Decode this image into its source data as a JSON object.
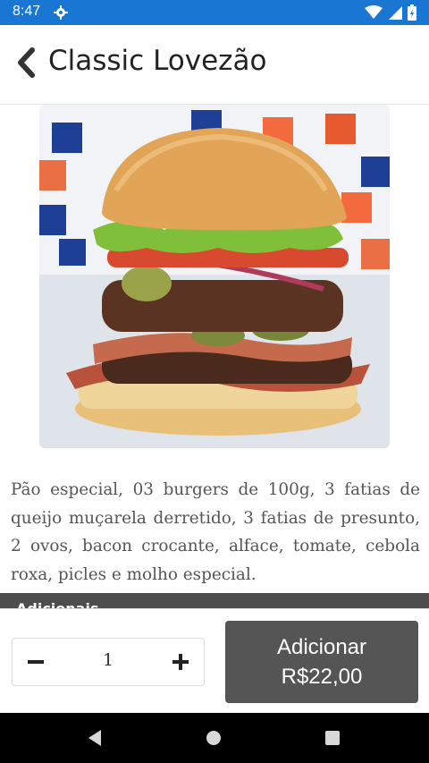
{
  "status_bar": {
    "time": "8:47",
    "icons": [
      "gear-icon",
      "wifi-icon",
      "signal-icon",
      "battery-icon"
    ],
    "color": "#1976d2"
  },
  "header": {
    "title": "Classic Lovezão",
    "back_icon": "chevron-left-icon"
  },
  "product": {
    "image": "burger-photo",
    "description": "Pão especial, 03 burgers de 100g, 3 fatias de queijo muçarela derretido, 3 fatias de presunto, 2 ovos, bacon crocante, alface, tomate, cebola roxa, picles e molho especial."
  },
  "section": {
    "label": "Adicionais"
  },
  "order": {
    "quantity": "1",
    "add_label": "Adicionar",
    "price": "R$22,00",
    "button_color": "#555555"
  },
  "nav": {
    "icons": [
      "back-triangle-icon",
      "home-circle-icon",
      "recents-square-icon"
    ]
  }
}
